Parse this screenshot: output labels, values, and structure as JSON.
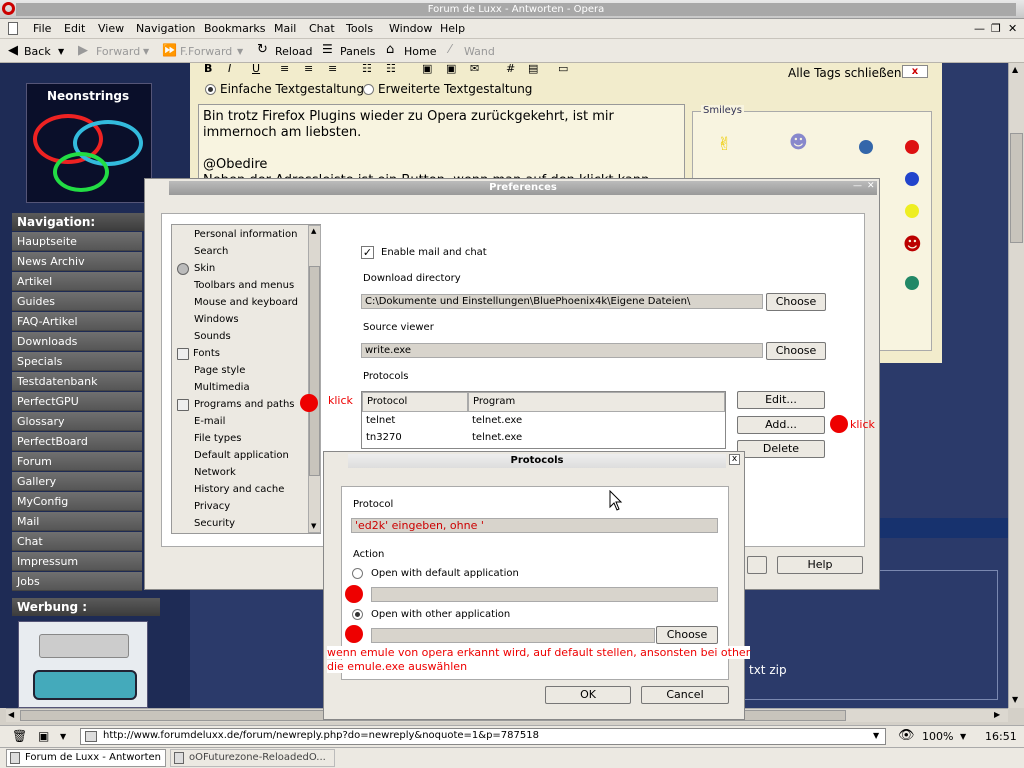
{
  "window": {
    "title": "Forum de Luxx - Antworten - Opera"
  },
  "menu": [
    "File",
    "Edit",
    "View",
    "Navigation",
    "Bookmarks",
    "Mail",
    "Chat",
    "Tools",
    "Window",
    "Help"
  ],
  "toolbar": {
    "back": "Back",
    "forward": "Forward",
    "fforward": "F.Forward",
    "reload": "Reload",
    "panels": "Panels",
    "home": "Home",
    "wand": "Wand"
  },
  "sidebar": {
    "banner_label": "Neonstrings",
    "nav_head": "Navigation:",
    "items": [
      "Hauptseite",
      "News Archiv",
      "Artikel",
      "Guides",
      "FAQ-Artikel",
      "Downloads",
      "Specials",
      "Testdatenbank",
      "PerfectGPU",
      "Glossary",
      "PerfectBoard",
      "Forum",
      "Gallery",
      "MyConfig",
      "Mail",
      "Chat",
      "Impressum",
      "Jobs"
    ],
    "ad_head": "Werbung :"
  },
  "editor": {
    "close_tags": "Alle Tags schließen",
    "close_x": "x",
    "simple": "Einfache Textgestaltung",
    "extended": "Erweiterte Textgestaltung",
    "text_line1": "Bin trotz Firefox Plugins wieder zu Opera zurückgekehrt, ist mir",
    "text_line2": "immernoch am liebsten.",
    "text_line3": "@Obedire",
    "text_line4": "Neben der Adressleiste ist ein Button, wenn man auf den klickt kann",
    "smileys": "Smileys",
    "attach_text": "txt zip"
  },
  "prefs": {
    "title": "Preferences",
    "list": [
      "Personal information",
      "Search",
      "Skin",
      "Toolbars and menus",
      "Mouse and keyboard",
      "Windows",
      "Sounds",
      "Fonts",
      "Page style",
      "Multimedia",
      "Programs and paths",
      "E-mail",
      "File types",
      "Default application",
      "Network",
      "History and cache",
      "Privacy",
      "Security"
    ],
    "enable_mail": "Enable mail and chat",
    "download_dir_label": "Download directory",
    "download_dir": "C:\\Dokumente und Einstellungen\\BluePhoenix4k\\Eigene Dateien\\",
    "choose": "Choose",
    "source_viewer_label": "Source viewer",
    "source_viewer": "write.exe",
    "protocols_label": "Protocols",
    "col_protocol": "Protocol",
    "col_program": "Program",
    "rows": [
      {
        "protocol": "telnet",
        "program": "telnet.exe"
      },
      {
        "protocol": "tn3270",
        "program": "telnet.exe"
      }
    ],
    "edit": "Edit...",
    "add": "Add...",
    "delete": "Delete",
    "help": "Help"
  },
  "protocols_dialog": {
    "title": "Protocols",
    "close": "x",
    "protocol_label": "Protocol",
    "protocol_value": "'ed2k' eingeben, ohne '",
    "action_label": "Action",
    "opt_default": "Open with default application",
    "opt_other": "Open with other application",
    "choose": "Choose",
    "ok": "OK",
    "cancel": "Cancel"
  },
  "annotations": {
    "klick1": "klick",
    "klick2": "klick",
    "note_line1": "wenn emule von opera erkannt wird, auf default stellen, ansonsten bei other",
    "note_line2": "die emule.exe auswählen"
  },
  "status": {
    "url": "http://www.forumdeluxx.de/forum/newreply.php?do=newreply&noquote=1&p=787518",
    "zoom": "100%",
    "time": "16:51"
  },
  "taskbar": {
    "tab1": "Forum de Luxx - Antworten",
    "tab2": "oOFuturezone-ReloadedO..."
  },
  "colors": {
    "red": "#e00000",
    "sidebar": "#1e2b55",
    "dialog": "#ece9e2"
  }
}
